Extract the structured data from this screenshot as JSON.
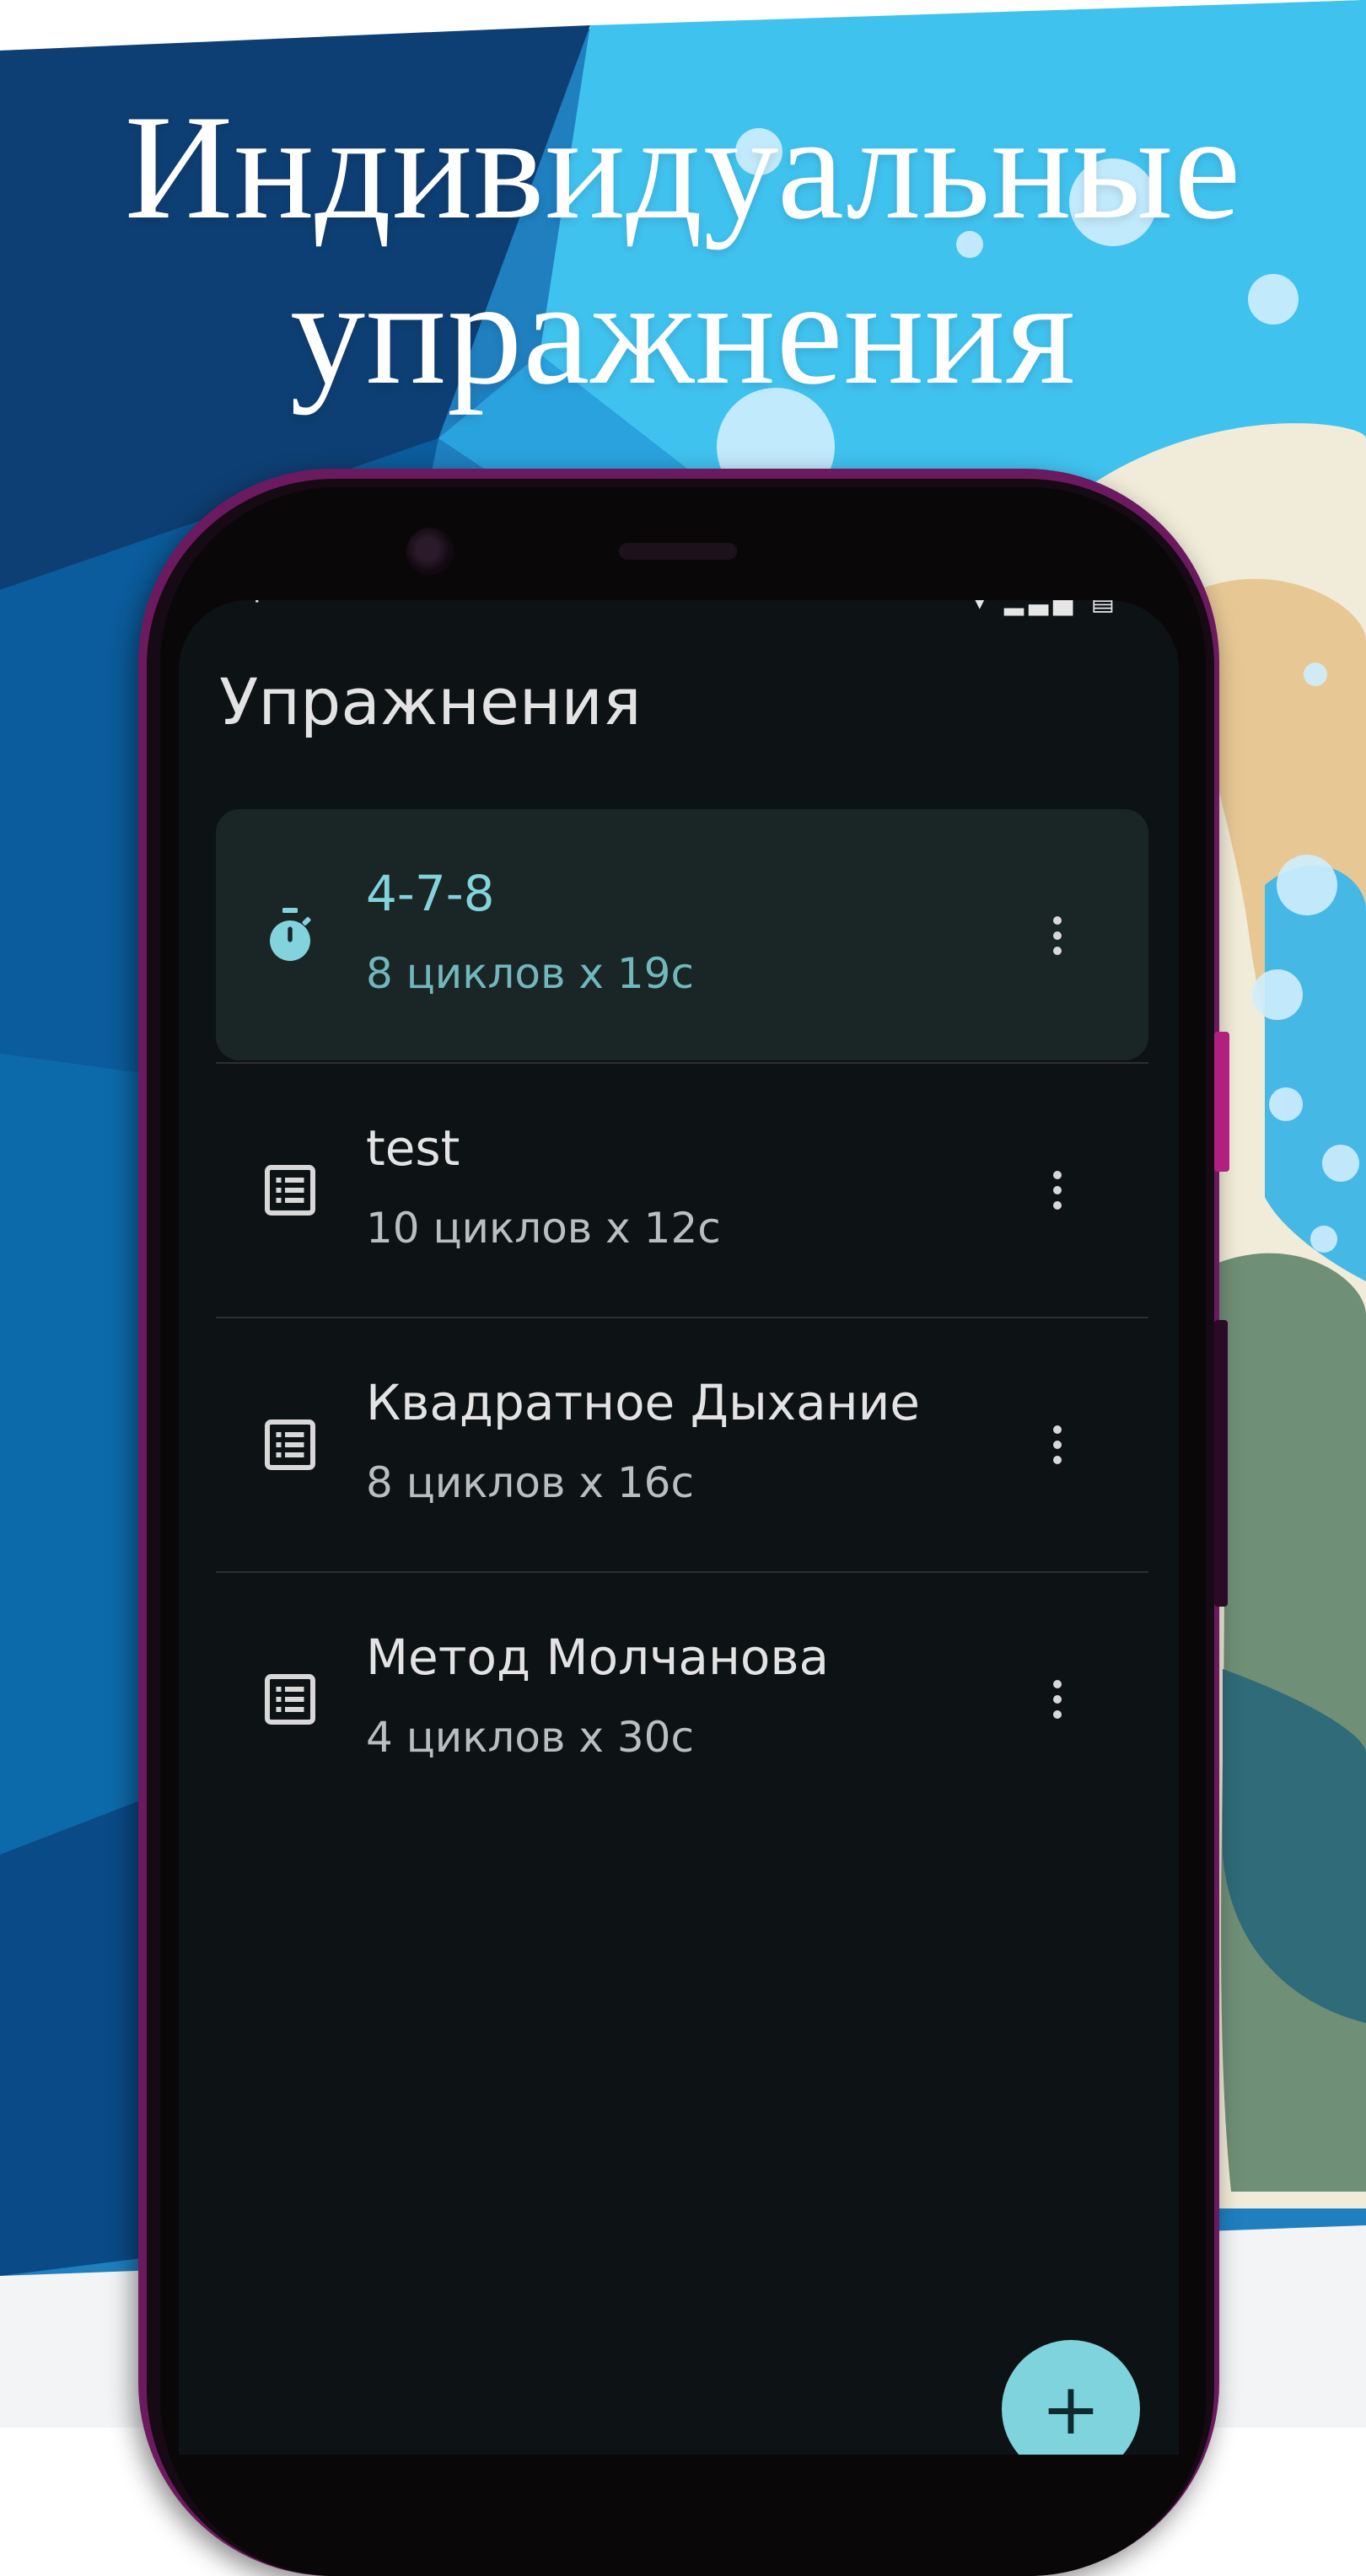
{
  "headline": {
    "line1": "Индивидуальные",
    "line2": "упражнения"
  },
  "screen": {
    "title": "Упражнения",
    "items": [
      {
        "icon": "timer-icon",
        "title": "4-7-8",
        "subtitle": "8 циклов x 19c",
        "selected": true
      },
      {
        "icon": "list-icon",
        "title": "test",
        "subtitle": "10 циклов x 12c",
        "selected": false
      },
      {
        "icon": "list-icon",
        "title": "Квадратное Дыхание",
        "subtitle": "8 циклов x 16c",
        "selected": false
      },
      {
        "icon": "list-icon",
        "title": "Метод Молчанова",
        "subtitle": "4 циклов x 30c",
        "selected": false
      }
    ],
    "fab_label": "+"
  },
  "colors": {
    "accent": "#82d3dc",
    "screen_background": "#0d1214",
    "selected_card": "#1a2526",
    "phone_frame": "#6b1a5f"
  }
}
